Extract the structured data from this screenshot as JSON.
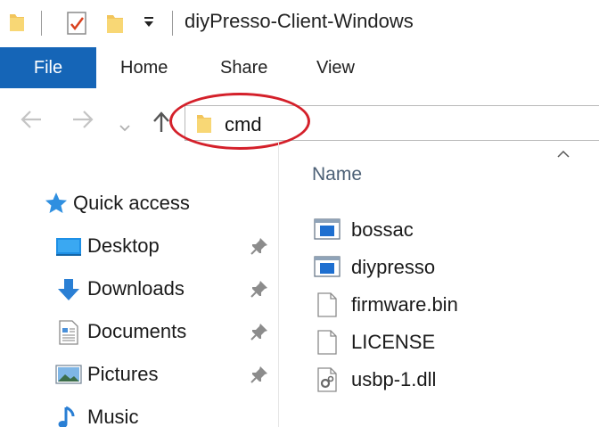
{
  "window": {
    "title": "diyPresso-Client-Windows"
  },
  "quick_access_toolbar": {
    "icons": [
      "folder-icon",
      "properties-checklist-icon",
      "new-folder-icon",
      "customize-dropdown-icon"
    ]
  },
  "ribbon": {
    "tabs": [
      {
        "label": "File",
        "active": true
      },
      {
        "label": "Home"
      },
      {
        "label": "Share"
      },
      {
        "label": "View"
      }
    ],
    "accent": "#1565b7"
  },
  "address_bar": {
    "text": "cmd",
    "annotation_color": "#d4202a"
  },
  "nav_pane": {
    "quick_access_label": "Quick access",
    "items": [
      {
        "label": "Desktop",
        "icon": "desktop-icon",
        "pinned": true
      },
      {
        "label": "Downloads",
        "icon": "downloads-icon",
        "pinned": true
      },
      {
        "label": "Documents",
        "icon": "documents-icon",
        "pinned": true
      },
      {
        "label": "Pictures",
        "icon": "pictures-icon",
        "pinned": true
      },
      {
        "label": "Music",
        "icon": "music-icon",
        "pinned": false
      }
    ]
  },
  "file_list": {
    "column_header": "Name",
    "files": [
      {
        "name": "bossac",
        "icon": "application-icon"
      },
      {
        "name": "diypresso",
        "icon": "application-icon"
      },
      {
        "name": "firmware.bin",
        "icon": "file-icon"
      },
      {
        "name": "LICENSE",
        "icon": "file-icon"
      },
      {
        "name": "usbp-1.dll",
        "icon": "dll-settings-file-icon"
      }
    ]
  }
}
